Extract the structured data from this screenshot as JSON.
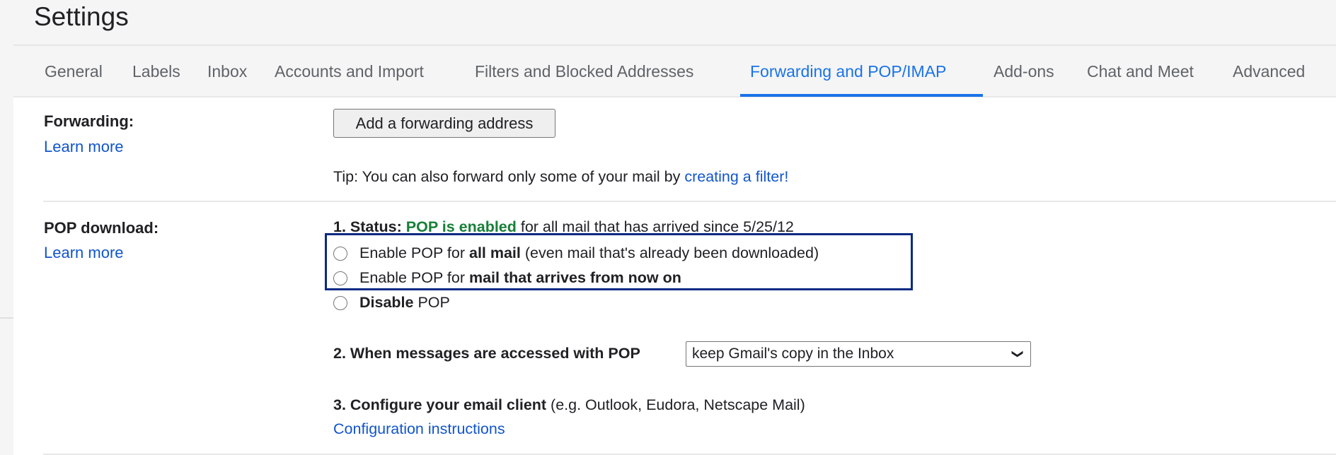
{
  "header": {
    "title": "Settings"
  },
  "tabs": [
    {
      "label": "General",
      "active": false
    },
    {
      "label": "Labels",
      "active": false
    },
    {
      "label": "Inbox",
      "active": false
    },
    {
      "label": "Accounts and Import",
      "active": false
    },
    {
      "label": "Filters and Blocked Addresses",
      "active": false
    },
    {
      "label": "Forwarding and POP/IMAP",
      "active": true
    },
    {
      "label": "Add-ons",
      "active": false
    },
    {
      "label": "Chat and Meet",
      "active": false
    },
    {
      "label": "Advanced",
      "active": false
    }
  ],
  "forwarding": {
    "label": "Forwarding:",
    "learn_more": "Learn more",
    "add_button": "Add a forwarding address",
    "tip_prefix": "Tip: You can also forward only some of your mail by ",
    "tip_link": "creating a filter!"
  },
  "pop": {
    "label": "POP download:",
    "learn_more": "Learn more",
    "status_prefix": "1. Status: ",
    "status_value": "POP is enabled",
    "status_suffix": " for all mail that has arrived since 5/25/12",
    "options": [
      {
        "pre": "Enable POP for ",
        "bold": "all mail",
        "post": " (even mail that's already been downloaded)",
        "checked": false
      },
      {
        "pre": "Enable POP for ",
        "bold": "mail that arrives from now on",
        "post": "",
        "checked": false
      },
      {
        "pre": "",
        "bold": "Disable",
        "post": " POP",
        "checked": false
      }
    ],
    "step2_label": "2. When messages are accessed with POP",
    "step2_value": "keep Gmail's copy in the Inbox",
    "step3_label": "3. Configure your email client",
    "step3_note": " (e.g. Outlook, Eudora, Netscape Mail)",
    "config_link": "Configuration instructions"
  },
  "colors": {
    "accent": "#1a73e8",
    "link": "#1155cc",
    "status_green": "#188038",
    "highlight_box": "#0b2a83"
  }
}
